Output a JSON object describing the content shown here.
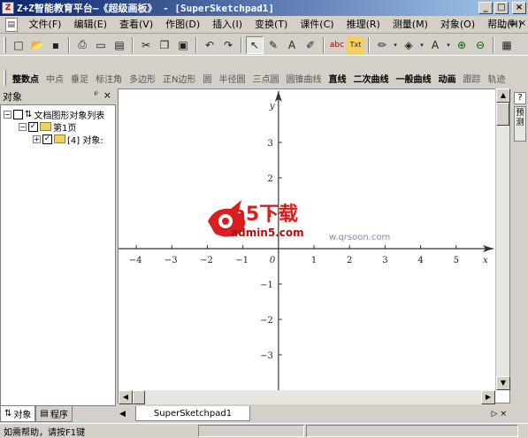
{
  "window": {
    "title": "Z+Z智能教育平台—《超级画板》 - [SuperSketchpad1]",
    "buttons": [
      "minimize",
      "maximize",
      "close"
    ]
  },
  "menubar": {
    "items": [
      "文件(F)",
      "编辑(E)",
      "查看(V)",
      "作图(D)",
      "插入(I)",
      "变换(T)",
      "课件(C)",
      "推理(R)",
      "测量(M)",
      "对象(O)",
      "帮助(H)"
    ]
  },
  "toolbar1": {
    "buttons": [
      "new-icon",
      "open-icon",
      "save-icon",
      "print-preview-icon",
      "print-icon",
      "print2-icon",
      "cut-icon",
      "copy-icon",
      "paste-icon",
      "undo-icon",
      "redo-icon",
      "select-arrow-icon",
      "pen-arrow-icon",
      "text-icon",
      "edit-pen-icon",
      "abc-icon",
      "label-icon",
      "line-color-icon",
      "fill-color-icon",
      "font-color-icon",
      "zoom-in-icon",
      "zoom-out-icon",
      "hide-icon"
    ]
  },
  "toolbar2": {
    "tools": [
      "整数点",
      "中点",
      "垂足",
      "标注角",
      "多边形",
      "正N边形",
      "圆",
      "半径圆",
      "三点圆",
      "圆锥曲线",
      "直线",
      "二次曲线",
      "一般曲线",
      "动画",
      "跟踪",
      "轨迹"
    ],
    "active": [
      "整数点",
      "直线",
      "二次曲线",
      "一般曲线",
      "动画"
    ]
  },
  "left_panel": {
    "title": "对象",
    "tree": [
      {
        "label": "文档图形对象列表",
        "level": 0,
        "expander": "-"
      },
      {
        "label": "第1页",
        "level": 1,
        "expander": "-"
      },
      {
        "label": "[4] 对象:",
        "level": 2,
        "expander": "+"
      }
    ],
    "tabs": [
      "对象",
      "程序"
    ]
  },
  "right_panel": {
    "tab": "预测"
  },
  "document_tab": "SuperSketchpad1",
  "status": {
    "text": "如需帮助，请按F1键"
  },
  "graph": {
    "x_axis_label": "x",
    "y_axis_label": "y",
    "origin_label": "0",
    "x_ticks": [
      -4,
      -3,
      -2,
      -1,
      1,
      2,
      3,
      4,
      5
    ],
    "y_ticks": [
      3,
      2,
      1,
      -1,
      -2,
      -3
    ],
    "x_range": [
      -4.5,
      6.1
    ],
    "y_range": [
      -4.0,
      4.5
    ]
  },
  "watermark": {
    "logo_text": "a5下载",
    "logo_sub": "admin5.com",
    "site_text": "w.qrsoon.com"
  }
}
